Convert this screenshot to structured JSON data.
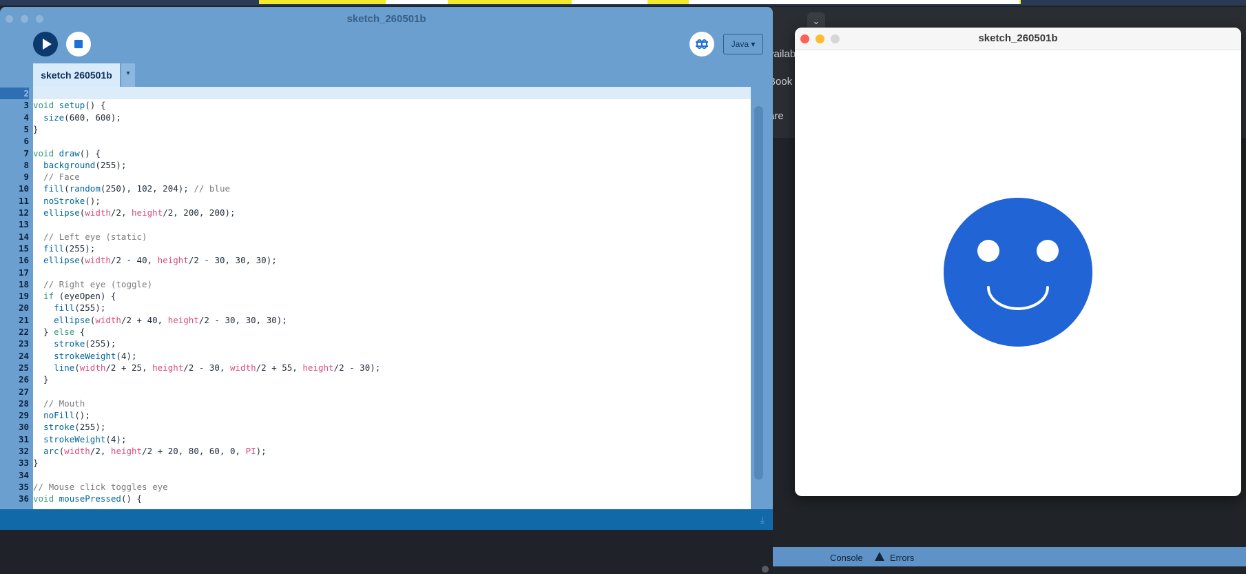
{
  "background": {
    "fragments": [
      "vailab",
      "Book",
      "are"
    ],
    "chevron": "⌄",
    "console_tab": "Console",
    "errors_tab": "Errors"
  },
  "ide": {
    "title": "sketch_260501b",
    "tab_label": "sketch 260501b",
    "tab_menu": "▾",
    "mode_label": "Java ▾",
    "code_lines": [
      {
        "n": "2",
        "parts": []
      },
      {
        "n": "3",
        "parts": [
          [
            "kw",
            "void "
          ],
          [
            "fn",
            "setup"
          ],
          [
            "def",
            "() {"
          ]
        ]
      },
      {
        "n": "4",
        "parts": [
          [
            "def",
            "  "
          ],
          [
            "fn",
            "size"
          ],
          [
            "def",
            "(600, 600);"
          ]
        ]
      },
      {
        "n": "5",
        "parts": [
          [
            "def",
            "}"
          ]
        ]
      },
      {
        "n": "6",
        "parts": []
      },
      {
        "n": "7",
        "parts": [
          [
            "kw",
            "void "
          ],
          [
            "fn",
            "draw"
          ],
          [
            "def",
            "() {"
          ]
        ]
      },
      {
        "n": "8",
        "parts": [
          [
            "def",
            "  "
          ],
          [
            "fn",
            "background"
          ],
          [
            "def",
            "(255);"
          ]
        ]
      },
      {
        "n": "9",
        "parts": [
          [
            "cm",
            "  // Face"
          ]
        ]
      },
      {
        "n": "10",
        "parts": [
          [
            "def",
            "  "
          ],
          [
            "fn",
            "fill"
          ],
          [
            "def",
            "("
          ],
          [
            "fn",
            "random"
          ],
          [
            "def",
            "(250), 102, 204); "
          ],
          [
            "cm",
            "// blue"
          ]
        ]
      },
      {
        "n": "11",
        "parts": [
          [
            "def",
            "  "
          ],
          [
            "fn",
            "noStroke"
          ],
          [
            "def",
            "();"
          ]
        ]
      },
      {
        "n": "12",
        "parts": [
          [
            "def",
            "  "
          ],
          [
            "fn",
            "ellipse"
          ],
          [
            "def",
            "("
          ],
          [
            "var",
            "width"
          ],
          [
            "def",
            "/2, "
          ],
          [
            "var",
            "height"
          ],
          [
            "def",
            "/2, 200, 200);"
          ]
        ]
      },
      {
        "n": "13",
        "parts": []
      },
      {
        "n": "14",
        "parts": [
          [
            "cm",
            "  // Left eye (static)"
          ]
        ]
      },
      {
        "n": "15",
        "parts": [
          [
            "def",
            "  "
          ],
          [
            "fn",
            "fill"
          ],
          [
            "def",
            "(255);"
          ]
        ]
      },
      {
        "n": "16",
        "parts": [
          [
            "def",
            "  "
          ],
          [
            "fn",
            "ellipse"
          ],
          [
            "def",
            "("
          ],
          [
            "var",
            "width"
          ],
          [
            "def",
            "/2 - 40, "
          ],
          [
            "var",
            "height"
          ],
          [
            "def",
            "/2 - 30, 30, 30);"
          ]
        ]
      },
      {
        "n": "17",
        "parts": []
      },
      {
        "n": "18",
        "parts": [
          [
            "cm",
            "  // Right eye (toggle)"
          ]
        ]
      },
      {
        "n": "19",
        "parts": [
          [
            "def",
            "  "
          ],
          [
            "kw",
            "if"
          ],
          [
            "def",
            " (eyeOpen) {"
          ]
        ]
      },
      {
        "n": "20",
        "parts": [
          [
            "def",
            "    "
          ],
          [
            "fn",
            "fill"
          ],
          [
            "def",
            "(255);"
          ]
        ]
      },
      {
        "n": "21",
        "parts": [
          [
            "def",
            "    "
          ],
          [
            "fn",
            "ellipse"
          ],
          [
            "def",
            "("
          ],
          [
            "var",
            "width"
          ],
          [
            "def",
            "/2 + 40, "
          ],
          [
            "var",
            "height"
          ],
          [
            "def",
            "/2 - 30, 30, 30);"
          ]
        ]
      },
      {
        "n": "22",
        "parts": [
          [
            "def",
            "  } "
          ],
          [
            "kw",
            "else"
          ],
          [
            "def",
            " {"
          ]
        ]
      },
      {
        "n": "23",
        "parts": [
          [
            "def",
            "    "
          ],
          [
            "fn",
            "stroke"
          ],
          [
            "def",
            "(255);"
          ]
        ]
      },
      {
        "n": "24",
        "parts": [
          [
            "def",
            "    "
          ],
          [
            "fn",
            "strokeWeight"
          ],
          [
            "def",
            "(4);"
          ]
        ]
      },
      {
        "n": "25",
        "parts": [
          [
            "def",
            "    "
          ],
          [
            "fn",
            "line"
          ],
          [
            "def",
            "("
          ],
          [
            "var",
            "width"
          ],
          [
            "def",
            "/2 + 25, "
          ],
          [
            "var",
            "height"
          ],
          [
            "def",
            "/2 - 30, "
          ],
          [
            "var",
            "width"
          ],
          [
            "def",
            "/2 + 55, "
          ],
          [
            "var",
            "height"
          ],
          [
            "def",
            "/2 - 30);"
          ]
        ]
      },
      {
        "n": "26",
        "parts": [
          [
            "def",
            "  }"
          ]
        ]
      },
      {
        "n": "27",
        "parts": []
      },
      {
        "n": "28",
        "parts": [
          [
            "cm",
            "  // Mouth"
          ]
        ]
      },
      {
        "n": "29",
        "parts": [
          [
            "def",
            "  "
          ],
          [
            "fn",
            "noFill"
          ],
          [
            "def",
            "();"
          ]
        ]
      },
      {
        "n": "30",
        "parts": [
          [
            "def",
            "  "
          ],
          [
            "fn",
            "stroke"
          ],
          [
            "def",
            "(255);"
          ]
        ]
      },
      {
        "n": "31",
        "parts": [
          [
            "def",
            "  "
          ],
          [
            "fn",
            "strokeWeight"
          ],
          [
            "def",
            "(4);"
          ]
        ]
      },
      {
        "n": "32",
        "parts": [
          [
            "def",
            "  "
          ],
          [
            "fn",
            "arc"
          ],
          [
            "def",
            "("
          ],
          [
            "var",
            "width"
          ],
          [
            "def",
            "/2, "
          ],
          [
            "var",
            "height"
          ],
          [
            "def",
            "/2 + 20, 80, 60, 0, "
          ],
          [
            "var",
            "PI"
          ],
          [
            "def",
            ");"
          ]
        ]
      },
      {
        "n": "33",
        "parts": [
          [
            "def",
            "}"
          ]
        ]
      },
      {
        "n": "34",
        "parts": []
      },
      {
        "n": "35",
        "parts": [
          [
            "cm",
            "// Mouse click toggles eye"
          ]
        ]
      },
      {
        "n": "36",
        "parts": [
          [
            "kw",
            "void "
          ],
          [
            "fn",
            "mousePressed"
          ],
          [
            "def",
            "() {"
          ]
        ]
      }
    ]
  },
  "sketch_window": {
    "title": "sketch_260501b",
    "face_color": "#2064d6",
    "eye_color": "#ffffff"
  }
}
